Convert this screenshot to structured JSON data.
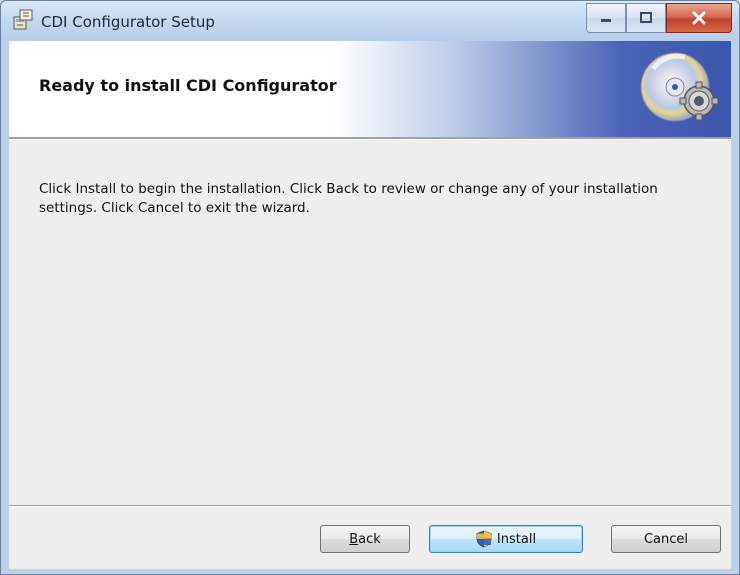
{
  "window": {
    "title": "CDI Configurator Setup",
    "icon": "installer-icon",
    "controls": [
      "minimize-icon",
      "maximize-icon",
      "close-icon"
    ]
  },
  "banner": {
    "title": "Ready to install CDI Configurator",
    "art": "cd-disc-icon"
  },
  "main": {
    "description": "Click Install to begin the installation. Click Back to review or change any of your installation settings. Click Cancel to exit the wizard."
  },
  "buttons": {
    "back": "Back",
    "back_mnemonic": "B",
    "back_rest": "ack",
    "install": "Install",
    "install_icon": "uac-shield-icon",
    "cancel": "Cancel"
  },
  "colors": {
    "banner_accent": "#3c56ad",
    "close_button": "#c0412a",
    "body_bg": "#eeeeee"
  }
}
